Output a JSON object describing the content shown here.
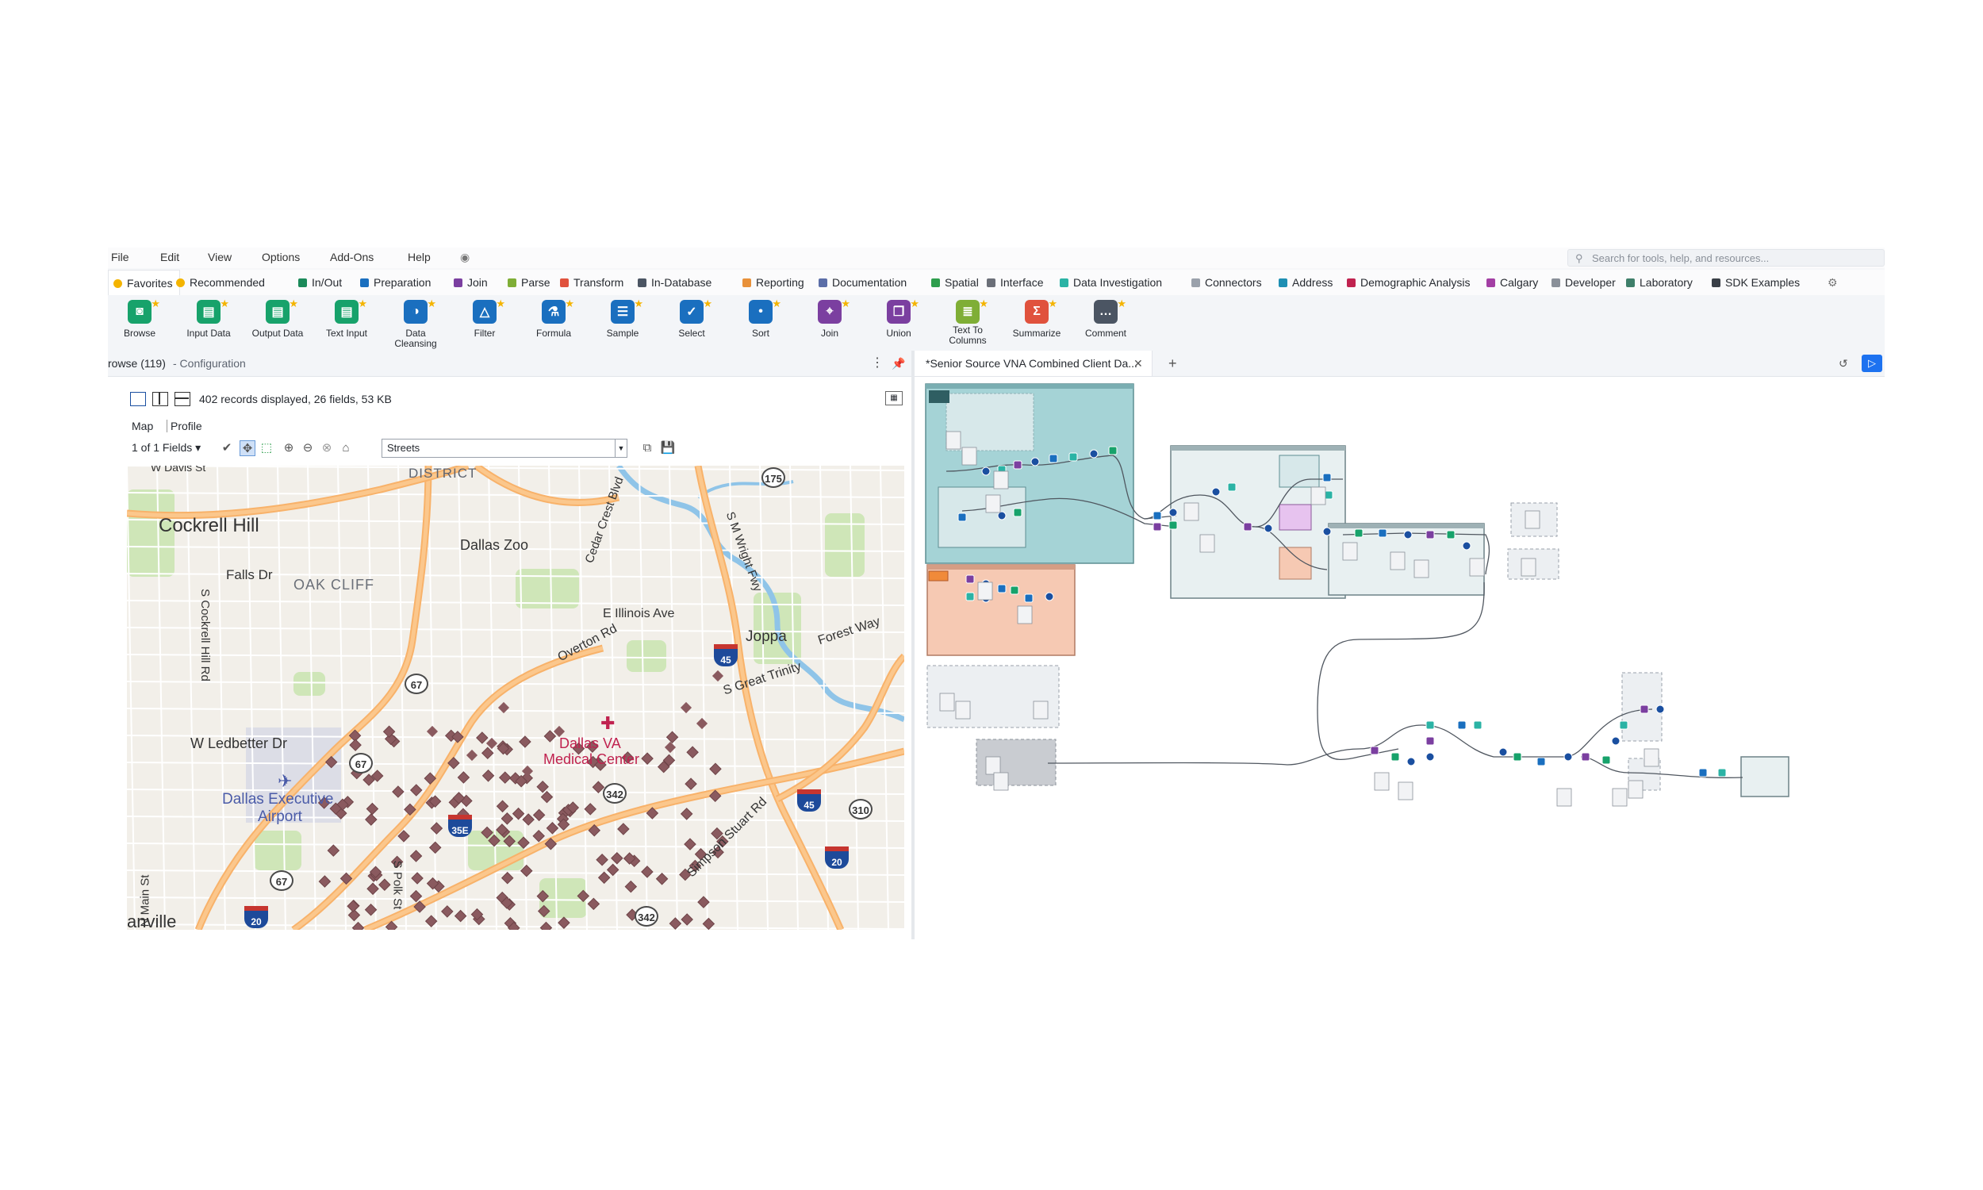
{
  "menu": [
    "File",
    "Edit",
    "View",
    "Options",
    "Add-Ons",
    "Help"
  ],
  "search": {
    "placeholder": "Search for tools, help, and resources..."
  },
  "categories": [
    {
      "label": "Favorites",
      "color": "#f4b400"
    },
    {
      "label": "Recommended",
      "color": "#f4b400"
    },
    {
      "label": "In/Out",
      "color": "#1b8a5a"
    },
    {
      "label": "Preparation",
      "color": "#1a6fbf"
    },
    {
      "label": "Join",
      "color": "#7b3fa0"
    },
    {
      "label": "Parse",
      "color": "#7fae36"
    },
    {
      "label": "Transform",
      "color": "#e0523d"
    },
    {
      "label": "In-Database",
      "color": "#4b5563"
    },
    {
      "label": "Reporting",
      "color": "#e8913a"
    },
    {
      "label": "Documentation",
      "color": "#5b6ea8"
    },
    {
      "label": "Spatial",
      "color": "#2e9e4d"
    },
    {
      "label": "Interface",
      "color": "#6b6f78"
    },
    {
      "label": "Data Investigation",
      "color": "#2bb3a5"
    },
    {
      "label": "Connectors",
      "color": "#9aa1ab"
    },
    {
      "label": "Address",
      "color": "#1e8fb3"
    },
    {
      "label": "Demographic Analysis",
      "color": "#c0224f"
    },
    {
      "label": "Calgary",
      "color": "#a33fa4"
    },
    {
      "label": "Developer",
      "color": "#8a9099"
    },
    {
      "label": "Laboratory",
      "color": "#3f7f6a"
    },
    {
      "label": "SDK Examples",
      "color": "#3a3f47"
    }
  ],
  "tools": [
    {
      "label": "Browse",
      "color": "#17a26b",
      "glyph": "binoculars-icon"
    },
    {
      "label": "Input Data",
      "color": "#17a26b",
      "glyph": "book-icon"
    },
    {
      "label": "Output Data",
      "color": "#17a26b",
      "glyph": "book-icon"
    },
    {
      "label": "Text Input",
      "color": "#17a26b",
      "glyph": "book-icon"
    },
    {
      "label": "Data Cleansing",
      "color": "#1a6fbf",
      "glyph": "brush-icon"
    },
    {
      "label": "Filter",
      "color": "#1a6fbf",
      "glyph": "triangle-icon"
    },
    {
      "label": "Formula",
      "color": "#1a6fbf",
      "glyph": "flask-icon"
    },
    {
      "label": "Sample",
      "color": "#1a6fbf",
      "glyph": "sample-icon"
    },
    {
      "label": "Select",
      "color": "#1a6fbf",
      "glyph": "check-icon"
    },
    {
      "label": "Sort",
      "color": "#1a6fbf",
      "glyph": "sort-icon"
    },
    {
      "label": "Join",
      "color": "#7b3fa0",
      "glyph": "join-icon"
    },
    {
      "label": "Union",
      "color": "#7b3fa0",
      "glyph": "union-icon"
    },
    {
      "label": "Text To\nColumns",
      "color": "#7fae36",
      "glyph": "split-icon"
    },
    {
      "label": "Summarize",
      "color": "#e0523d",
      "glyph": "sigma-icon"
    },
    {
      "label": "Comment",
      "color": "#4b5563",
      "glyph": "speech-bubble-icon"
    }
  ],
  "leftpanel": {
    "title": "rowse (119)",
    "subtitle": "- Configuration",
    "records_info": "402 records displayed, 26 fields, 53 KB",
    "tabs": [
      "Map",
      "Profile"
    ],
    "fields": "1 of 1 Fields",
    "layer": "Streets"
  },
  "map": {
    "labels": [
      {
        "text": "DISTRICT"
      },
      {
        "text": "Cockrell Hill"
      },
      {
        "text": "Dallas Zoo"
      },
      {
        "text": "Falls Dr"
      },
      {
        "text": "OAK CLIFF"
      },
      {
        "text": "E Illinois Ave"
      },
      {
        "text": "Joppa"
      },
      {
        "text": "Overton Rd"
      },
      {
        "text": "W Ledbetter Dr"
      },
      {
        "text": "Dallas VA"
      },
      {
        "text": "Medical Center"
      },
      {
        "text": "Dallas Executive"
      },
      {
        "text": "Airport"
      },
      {
        "text": "Cedar Crest Blvd"
      },
      {
        "text": "S M Wright Fwy"
      },
      {
        "text": "Forest Way"
      },
      {
        "text": "S Great Trinity"
      },
      {
        "text": "Simpson Stuart Rd"
      },
      {
        "text": "S Cockrell Hill Rd"
      },
      {
        "text": "S Polk St"
      },
      {
        "text": "N Main St"
      },
      {
        "text": "anville"
      },
      {
        "text": "W Davis St"
      }
    ],
    "shields": [
      "175",
      "67",
      "67",
      "67",
      "342",
      "342",
      "310"
    ],
    "interstates": [
      "45",
      "35E",
      "45",
      "20",
      "20"
    ]
  },
  "canvas": {
    "doc_tab": "*Senior Source VNA Combined Client Da..."
  }
}
